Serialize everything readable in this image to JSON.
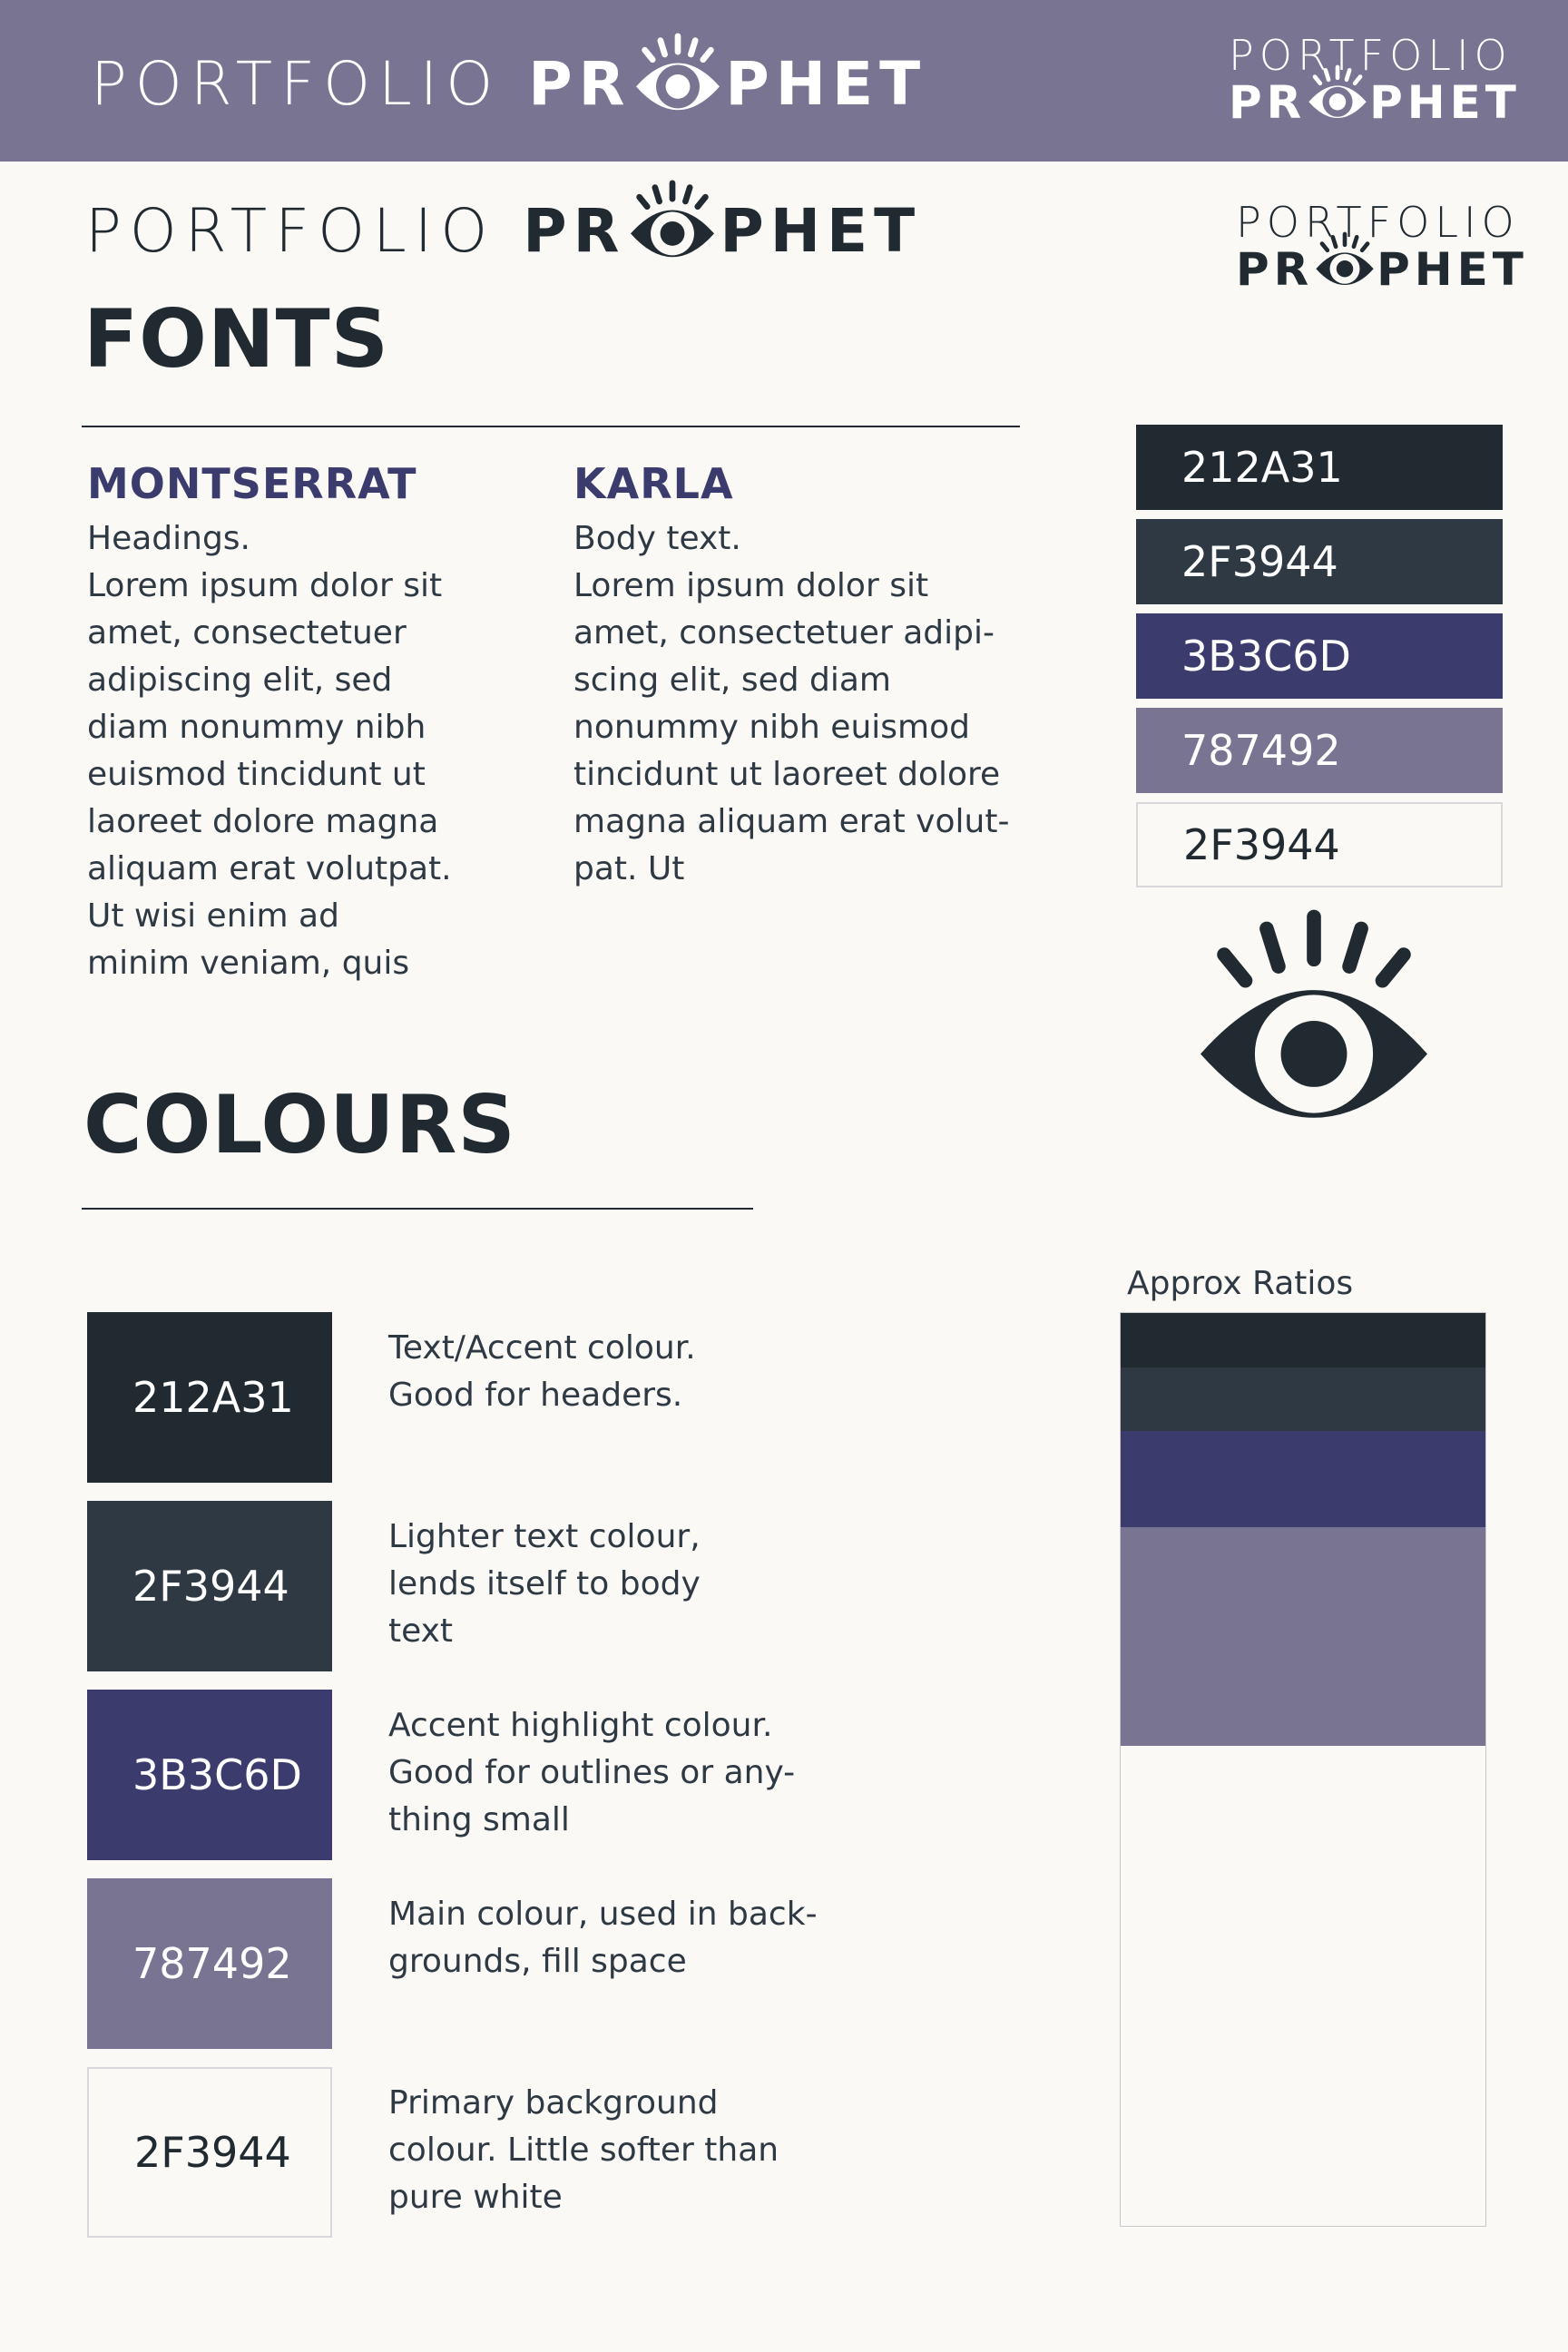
{
  "brand": {
    "name_light": "PORTFOLIO",
    "name_bold_left": "PR",
    "name_bold_right": "PHET",
    "eye_icon": "eye-icon"
  },
  "colors": {
    "dark": "#212A31",
    "slate": "#2F3944",
    "indigo": "#3B3C6D",
    "lavender": "#787492",
    "offwhite": "#FAF9F5"
  },
  "fonts_section": {
    "title": "FONTS",
    "heading_font": {
      "name": "MONTSERRAT",
      "usage": "Headings.",
      "sample": "Lorem ipsum dolor sit\namet, consectetuer\nadipiscing elit, sed\ndiam nonummy nibh\neuismod tincidunt ut\nlaoreet dolore magna\naliquam erat volutpat.\nUt wisi enim ad\nminim veniam, quis"
    },
    "body_font": {
      "name": "KARLA",
      "usage": "Body text.",
      "sample": "Lorem ipsum dolor sit\namet, consectetuer adipi-\nscing elit, sed diam\nnonummy nibh euismod\ntincidunt ut laoreet dolore\nmagna aliquam erat volut-\npat. Ut"
    }
  },
  "palette_column": [
    {
      "code": "212A31",
      "bg": "#212A31",
      "fg": "#FFFFFF"
    },
    {
      "code": "2F3944",
      "bg": "#2F3944",
      "fg": "#FFFFFF"
    },
    {
      "code": "3B3C6D",
      "bg": "#3B3C6D",
      "fg": "#FFFFFF"
    },
    {
      "code": "787492",
      "bg": "#787492",
      "fg": "#FFFFFF"
    },
    {
      "code": "2F3944",
      "bg": "#FAF9F5",
      "fg": "#212A31"
    }
  ],
  "colours_section": {
    "title": "COLOURS",
    "swatches": [
      {
        "code": "212A31",
        "bg": "#212A31",
        "fg": "#FFFFFF",
        "description": "Text/Accent colour.\nGood for headers."
      },
      {
        "code": "2F3944",
        "bg": "#2F3944",
        "fg": "#FFFFFF",
        "description": "Lighter text colour,\nlends itself to body\ntext"
      },
      {
        "code": "3B3C6D",
        "bg": "#3B3C6D",
        "fg": "#FFFFFF",
        "description": "Accent highlight colour.\nGood for outlines or any-\nthing small"
      },
      {
        "code": "787492",
        "bg": "#787492",
        "fg": "#FFFFFF",
        "description": "Main colour, used in back-\ngrounds, fill space"
      },
      {
        "code": "2F3944",
        "bg": "#FAF9F5",
        "fg": "#212A31",
        "description": "Primary background\ncolour. Little softer than\npure white"
      }
    ]
  },
  "ratios": {
    "label": "Approx Ratios",
    "segments": [
      {
        "color": "#212A31",
        "fraction": 0.06
      },
      {
        "color": "#2F3944",
        "fraction": 0.07
      },
      {
        "color": "#3B3C6D",
        "fraction": 0.105
      },
      {
        "color": "#787492",
        "fraction": 0.24
      },
      {
        "color": "#FAF9F5",
        "fraction": 0.525
      }
    ]
  }
}
